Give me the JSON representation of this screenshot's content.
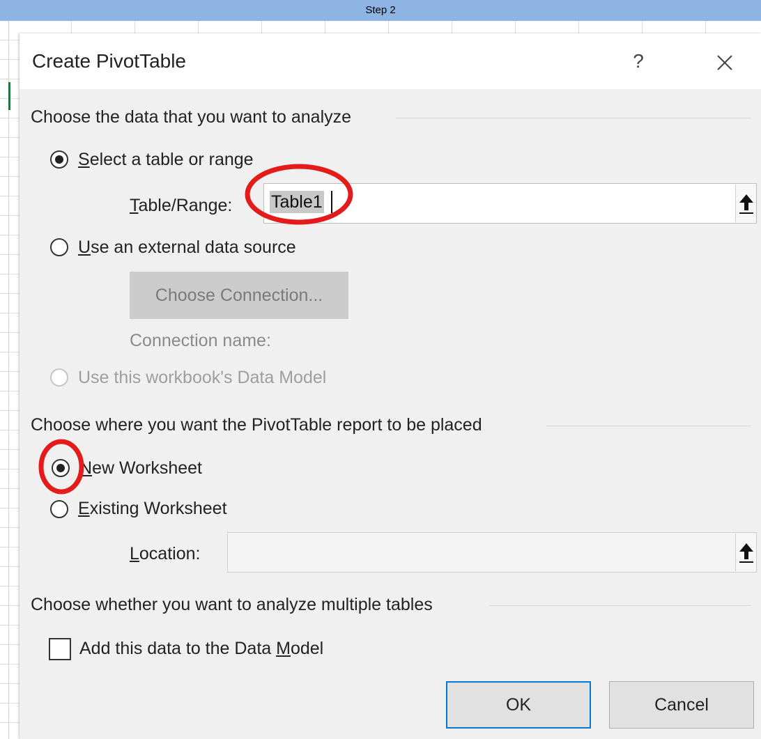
{
  "step_banner": "Step 2",
  "dialog": {
    "title": "Create PivotTable",
    "help_label": "?",
    "section1": {
      "heading": "Choose the data that you want to analyze",
      "option_table": {
        "accel": "S",
        "rest": "elect a table or range",
        "checked": true
      },
      "table_range": {
        "accel": "T",
        "rest": "able/Range:",
        "value": "Table1"
      },
      "option_external": {
        "accel": "U",
        "rest": "se an external data source",
        "checked": false
      },
      "choose_connection_label": "Choose Connection...",
      "connection_name_label": "Connection name:",
      "option_data_model": {
        "label": "Use this workbook's Data Model",
        "enabled": false
      }
    },
    "section2": {
      "heading": "Choose where you want the PivotTable report to be placed",
      "option_new": {
        "accel": "N",
        "rest": "ew Worksheet",
        "checked": true
      },
      "option_existing": {
        "accel": "E",
        "rest": "xisting Worksheet",
        "checked": false
      },
      "location": {
        "accel": "L",
        "rest": "ocation:",
        "value": ""
      }
    },
    "section3": {
      "heading": "Choose whether you want to analyze multiple tables",
      "checkbox": {
        "pre": "Add this data to the Data ",
        "accel": "M",
        "post": "odel",
        "checked": false
      }
    },
    "ok_label": "OK",
    "cancel_label": "Cancel"
  },
  "colors": {
    "banner": "#8db4e2",
    "dialog_bg": "#f0f0f0",
    "annotation_red": "#e31b1b",
    "default_button_border": "#0078d7"
  }
}
